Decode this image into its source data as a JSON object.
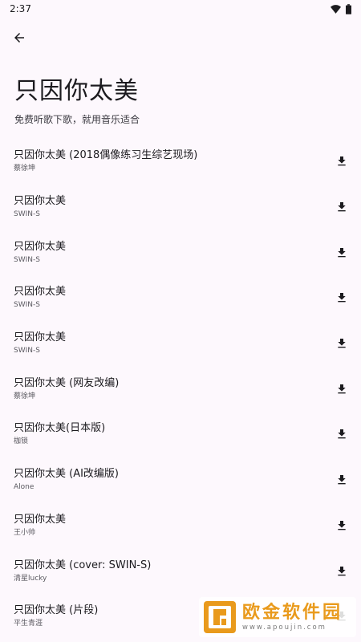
{
  "status": {
    "time": "2:37"
  },
  "header": {
    "title": "只因你太美",
    "subtitle": "免费听歌下歌，就用音乐适合"
  },
  "songs": [
    {
      "title": "只因你太美 (2018偶像练习生综艺现场)",
      "artist": "蔡徐坤"
    },
    {
      "title": "只因你太美",
      "artist": "SWIN-S"
    },
    {
      "title": "只因你太美",
      "artist": "SWIN-S"
    },
    {
      "title": "只因你太美",
      "artist": "SWIN-S"
    },
    {
      "title": "只因你太美",
      "artist": "SWIN-S"
    },
    {
      "title": "只因你太美 (网友改编)",
      "artist": "蔡徐坤"
    },
    {
      "title": "只因你太美(日本版)",
      "artist": "枷锁"
    },
    {
      "title": "只因你太美 (AI改编版)",
      "artist": "Alone"
    },
    {
      "title": "只因你太美",
      "artist": "王小帅"
    },
    {
      "title": "只因你太美 (cover: SWIN-S)",
      "artist": "清星lucky"
    },
    {
      "title": "只因你太美 (片段)",
      "artist": "平生青涯"
    }
  ],
  "watermark": {
    "text": "欧金软件园",
    "url": "www.apoujin.com"
  },
  "icons": {
    "back": "arrow-left-icon",
    "download": "download-icon",
    "wifi": "wifi-icon",
    "battery": "battery-icon"
  }
}
